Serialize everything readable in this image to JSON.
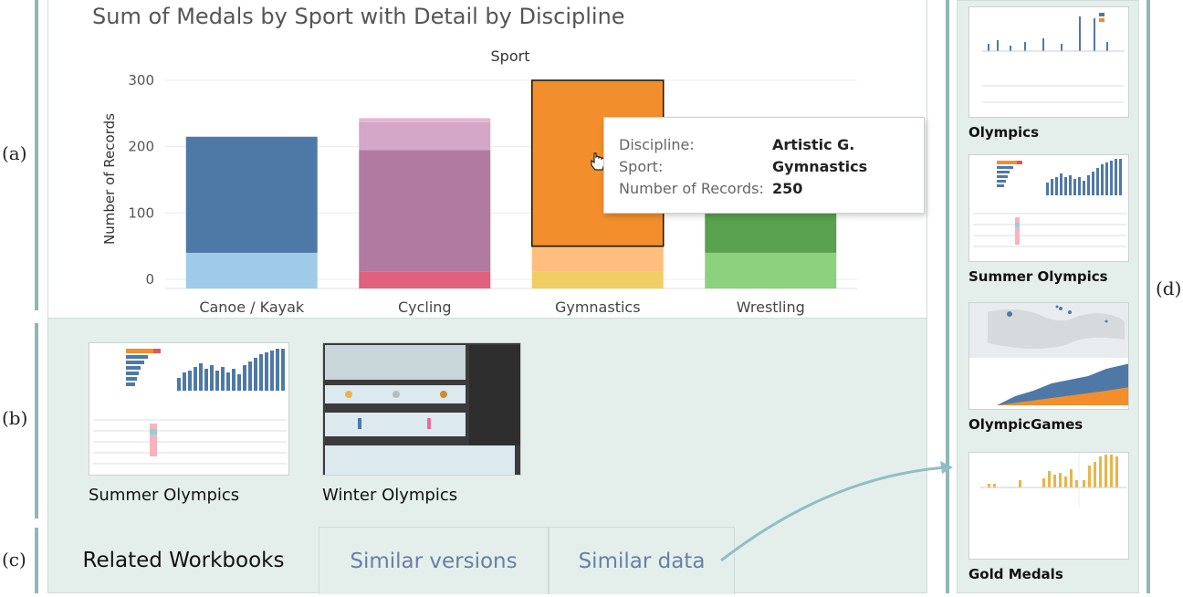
{
  "labels": {
    "a": "(a)",
    "b": "(b)",
    "c": "(c)",
    "d": "(d)"
  },
  "chart_data": {
    "type": "bar",
    "title": "Sum of Medals by Sport with Detail by Discipline",
    "subtitle": "Sport",
    "ylabel": "Number of Records",
    "ylim": [
      0,
      300
    ],
    "yticks": [
      0,
      100,
      200,
      300
    ],
    "categories": [
      "Canoe / Kayak",
      "Cycling",
      "Gymnastics",
      "Wrestling"
    ],
    "stacks": [
      {
        "category": "Canoe / Kayak",
        "segments": [
          {
            "value": 40,
            "color": "#a0cbe8"
          },
          {
            "value": 175,
            "color": "#4e79a7"
          }
        ]
      },
      {
        "category": "Cycling",
        "segments": [
          {
            "value": 12,
            "color": "#e0607e"
          },
          {
            "value": 183,
            "color": "#b07aa1"
          },
          {
            "value": 42,
            "color": "#d4a6c8"
          },
          {
            "value": 6,
            "color": "#e9b4cf"
          }
        ]
      },
      {
        "category": "Gymnastics",
        "segments": [
          {
            "value": 12,
            "color": "#f1ce63"
          },
          {
            "value": 38,
            "color": "#ffbe7d"
          },
          {
            "value": 250,
            "color": "#f28e2b"
          }
        ]
      },
      {
        "category": "Wrestling",
        "segments": [
          {
            "value": 40,
            "color": "#8cd17d"
          },
          {
            "value": 160,
            "color": "#59a14f"
          }
        ]
      }
    ],
    "tooltip": {
      "rows": [
        {
          "key": "Discipline:",
          "value": "Artistic G."
        },
        {
          "key": "Sport:",
          "value": "Gymnastics"
        },
        {
          "key": "Number of Records:",
          "value": "250"
        }
      ]
    }
  },
  "workbooks": [
    {
      "title": "Summer Olympics"
    },
    {
      "title": "Winter Olympics"
    }
  ],
  "tabs": [
    {
      "label": "Related Workbooks",
      "active": true
    },
    {
      "label": "Similar versions",
      "active": false
    },
    {
      "label": "Similar data",
      "active": false
    }
  ],
  "related": [
    {
      "title": "Olympics"
    },
    {
      "title": "Summer Olympics"
    },
    {
      "title": "OlympicGames"
    },
    {
      "title": "Gold Medals"
    }
  ],
  "colors": {
    "accent": "#8fb6b8",
    "panel": "#e4efec",
    "tab_inactive": "#6a7fa6"
  },
  "icons": {
    "cursor": "hand-pointer-icon"
  }
}
